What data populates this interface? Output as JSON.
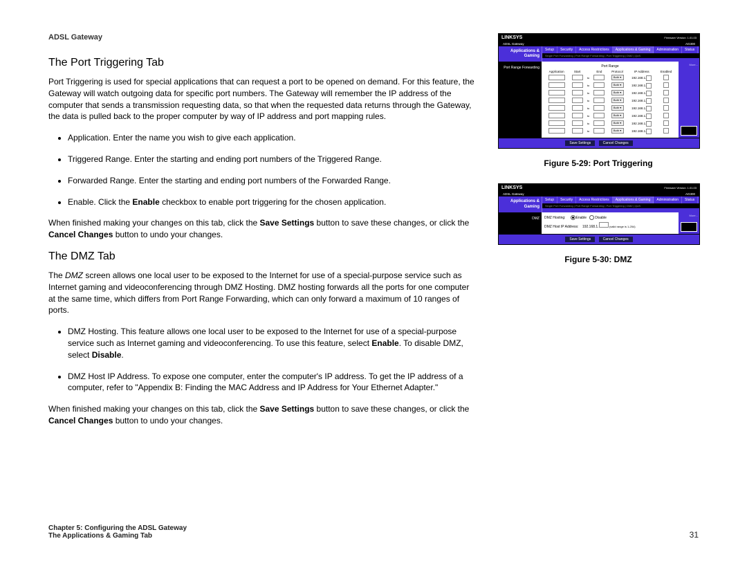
{
  "header": {
    "product": "ADSL Gateway"
  },
  "section1": {
    "heading": "The Port Triggering Tab",
    "intro": "Port Triggering is used for special applications that can request a port to be opened on demand. For this feature, the Gateway will watch outgoing data for specific port numbers. The Gateway will remember the IP address of the computer that sends a transmission requesting data, so that when the requested data returns through the Gateway, the data is pulled back to the proper computer by way of IP address and port mapping rules.",
    "bullets": [
      "Application. Enter the name you wish to give each application.",
      "Triggered Range. Enter the starting and ending port numbers of the Triggered Range.",
      "Forwarded Range. Enter the starting and ending port numbers of the Forwarded Range."
    ],
    "bullet_enable_pre": "Enable. Click the ",
    "bullet_enable_bold": "Enable",
    "bullet_enable_post": " checkbox to enable port triggering for the chosen application.",
    "closing_pre": "When finished making your changes on this tab, click the ",
    "closing_b1": "Save Settings",
    "closing_mid": " button to save these changes, or click the ",
    "closing_b2": "Cancel Changes",
    "closing_post": " button to undo your changes."
  },
  "section2": {
    "heading": "The DMZ Tab",
    "intro_pre": "The ",
    "intro_i": "DMZ",
    "intro_post": " screen allows one local user to be exposed to the Internet for use of a special-purpose service such as Internet gaming and videoconferencing through DMZ Hosting. DMZ hosting forwards all the ports for one computer at the same time, which differs from Port Range Forwarding, which can only forward a maximum of 10 ranges of ports.",
    "bullet1_pre": "DMZ Hosting. This feature allows one local user to be exposed to the Internet for use of a special-purpose service such as Internet gaming and videoconferencing. To use this feature, select ",
    "bullet1_b1": "Enable",
    "bullet1_mid": ". To disable DMZ, select ",
    "bullet1_b2": "Disable",
    "bullet1_post": ".",
    "bullet2": "DMZ Host IP Address. To expose one computer, enter the computer's IP address. To get the IP address of a computer, refer to \"Appendix B: Finding the MAC Address and IP Address for Your Ethernet Adapter.\"",
    "closing_pre": "When finished making your changes on this tab, click the ",
    "closing_b1": "Save Settings",
    "closing_mid": " button to save these changes, or click the ",
    "closing_b2": "Cancel Changes",
    "closing_post": " button to undo your changes."
  },
  "fig1": {
    "caption": "Figure 5-29: Port Triggering",
    "brand": "LINKSYS",
    "firmware": "Firmware Version: 1.01.03",
    "titlebar_left": "ADSL Gateway",
    "titlebar_right": "AG300",
    "side": "Applications & Gaming",
    "tabs": [
      "Setup",
      "Security",
      "Access Restrictions",
      "Applications & Gaming",
      "Administration",
      "Status"
    ],
    "subnav": "Single Port Forwarding  |  Port Range Forwarding  |  Port Triggering  |  DMZ  |  QoS",
    "sub_active": "Port Triggering",
    "panel_label": "Port Range Forwarding",
    "table_group": "Port Range",
    "headers": [
      "Application",
      "Start",
      "End",
      "Protocol",
      "IP Address",
      "Enabled"
    ],
    "protocol": "Both",
    "ip_prefix": "192.168.1.",
    "to": "to",
    "rows": 8,
    "btn_save": "Save Settings",
    "btn_cancel": "Cancel Changes",
    "more": "More..."
  },
  "fig2": {
    "caption": "Figure 5-30: DMZ",
    "brand": "LINKSYS",
    "firmware": "Firmware Version: 1.01.03",
    "titlebar_left": "ADSL Gateway",
    "titlebar_right": "AG300",
    "side": "Applications & Gaming",
    "tabs": [
      "Setup",
      "Security",
      "Access Restrictions",
      "Applications & Gaming",
      "Administration",
      "Status"
    ],
    "subnav": "Single Port Forwarding  |  Port Range Forwarding  |  Port Triggering  |  DMZ  |  QoS",
    "sub_active": "DMZ",
    "panel_label": "DMZ",
    "row1_label": "DMZ Hosting:",
    "row1_opt1": "Enable",
    "row1_opt2": "Disable",
    "row2_label": "DMZ Host IP Address:",
    "row2_prefix": "192.168.1.",
    "row2_hint": "(valid range is 1-254)",
    "btn_save": "Save Settings",
    "btn_cancel": "Cancel Changes",
    "more": "More..."
  },
  "footer": {
    "line1": "Chapter 5: Configuring the ADSL Gateway",
    "line2": "The Applications & Gaming Tab",
    "page": "31"
  }
}
